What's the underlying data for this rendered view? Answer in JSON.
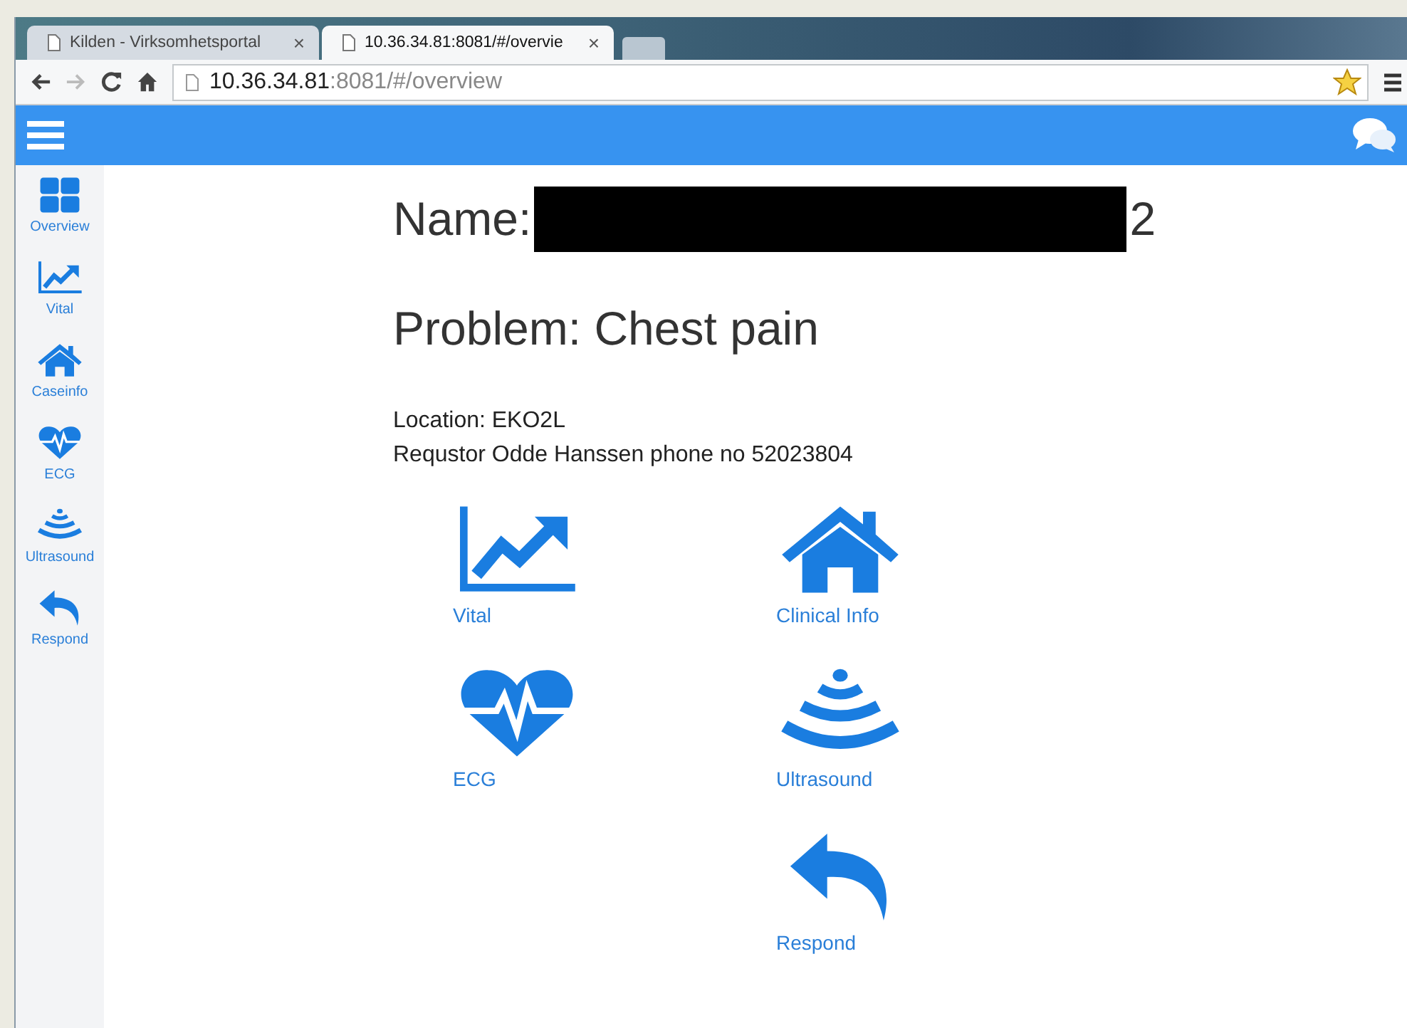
{
  "browser": {
    "tabs": [
      {
        "title": "Kilden - Virksomhetsportal",
        "close": "×",
        "selected": false
      },
      {
        "title": "10.36.34.81:8081/#/overvie",
        "close": "×",
        "selected": true
      }
    ],
    "address": {
      "host": "10.36.34.81",
      "rest": ":8081/#/overview"
    }
  },
  "sidebar": {
    "items": [
      {
        "kind": "grid",
        "label": "Overview"
      },
      {
        "kind": "chart",
        "label": "Vital"
      },
      {
        "kind": "house",
        "label": "Caseinfo"
      },
      {
        "kind": "heart",
        "label": "ECG"
      },
      {
        "kind": "waves",
        "label": "Ultrasound"
      },
      {
        "kind": "reply",
        "label": "Respond"
      }
    ]
  },
  "patient": {
    "name_label": "Name:",
    "name_tail": "2",
    "problem": "Problem: Chest pain",
    "location": "Location: EKO2L",
    "requestor": "Requstor Odde Hanssen phone no 52023804"
  },
  "tiles": [
    {
      "kind": "chart",
      "label": "Vital"
    },
    {
      "kind": "house",
      "label": "Clinical Info"
    },
    {
      "kind": "heart",
      "label": "ECG"
    },
    {
      "kind": "waves",
      "label": "Ultrasound"
    },
    {
      "kind": "reply",
      "label": "Respond"
    }
  ]
}
